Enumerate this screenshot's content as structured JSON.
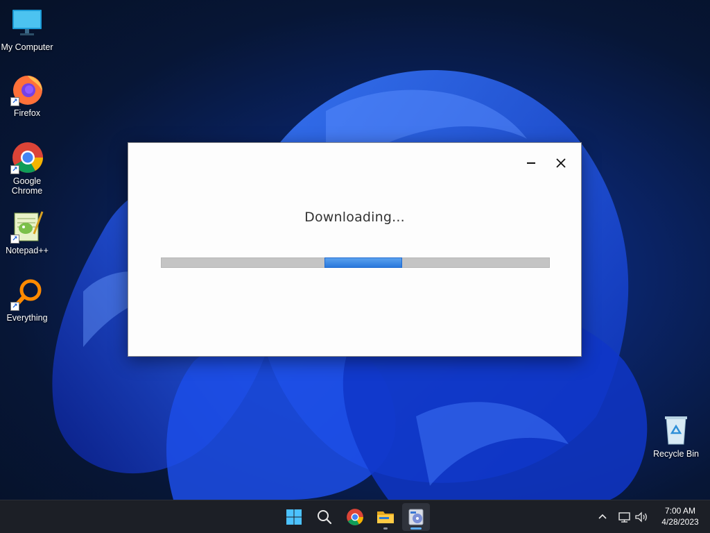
{
  "desktop": {
    "icons": [
      {
        "label": "My Computer",
        "icon": "monitor-icon"
      },
      {
        "label": "Firefox",
        "icon": "firefox-icon"
      },
      {
        "label": "Google Chrome",
        "icon": "chrome-icon"
      },
      {
        "label": "Notepad++",
        "icon": "notepadpp-icon"
      },
      {
        "label": "Everything",
        "icon": "everything-search-icon"
      },
      {
        "label": "Recycle Bin",
        "icon": "recycle-bin-icon"
      }
    ]
  },
  "dialog": {
    "status": "Downloading...",
    "progress_mode": "indeterminate",
    "progress_color": "#2f7fe0"
  },
  "taskbar": {
    "apps": [
      {
        "name": "Start",
        "icon": "windows-start-icon"
      },
      {
        "name": "Search",
        "icon": "search-icon"
      },
      {
        "name": "Google Chrome",
        "icon": "chrome-icon"
      },
      {
        "name": "File Explorer",
        "icon": "folder-icon"
      },
      {
        "name": "Installer",
        "icon": "installer-icon",
        "active": true
      }
    ],
    "tray": {
      "time": "7:00 AM",
      "date": "4/28/2023"
    }
  }
}
